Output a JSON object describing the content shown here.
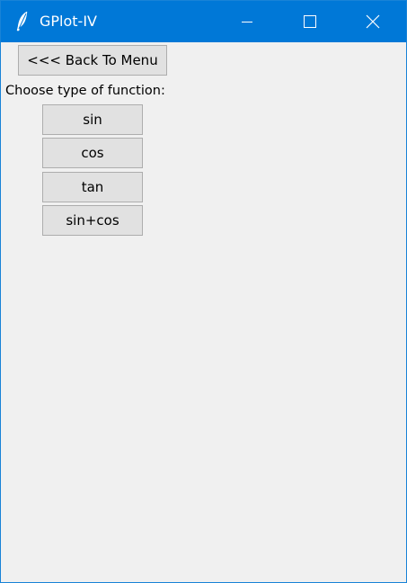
{
  "window": {
    "title": "GPlot-IV",
    "icon": "feather-icon",
    "controls": {
      "minimize": "minimize-icon",
      "maximize": "maximize-icon",
      "close": "close-icon"
    }
  },
  "content": {
    "back_button_label": "<<< Back To Menu",
    "prompt": "Choose type of function:",
    "functions": [
      {
        "label": "sin"
      },
      {
        "label": "cos"
      },
      {
        "label": "tan"
      },
      {
        "label": "sin+cos"
      }
    ]
  },
  "colors": {
    "titlebar": "#0078d7",
    "background": "#f0f0f0",
    "button_face": "#e1e1e1",
    "button_border": "#adadad"
  }
}
